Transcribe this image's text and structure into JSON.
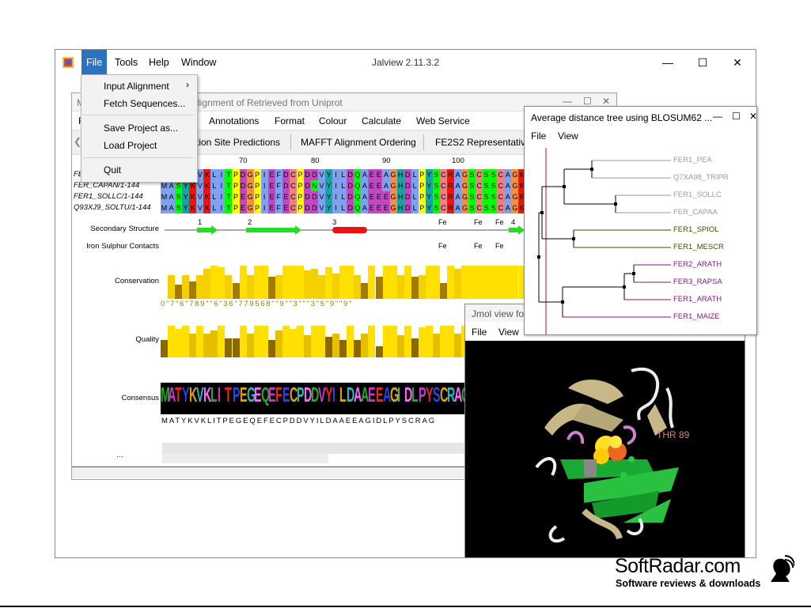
{
  "main_window": {
    "title": "Jalview 2.11.3.2",
    "menu": [
      "File",
      "Tools",
      "Help",
      "Window"
    ]
  },
  "file_menu": {
    "items": [
      "Input Alignment",
      "Fetch Sequences...",
      "Save Project as...",
      "Load Project",
      "Quit"
    ]
  },
  "alignment_frame": {
    "title_partial": "M",
    "title_rest": "lignment of Retrieved from Uniprot",
    "menu_partial": "F",
    "menu": [
      "Annotations",
      "Format",
      "Colour",
      "Calculate",
      "Web Service"
    ],
    "tabs": [
      "tion Site Predictions",
      "MAFFT Alignment Ordering",
      "FE2S2 Representatives"
    ],
    "ruler": [
      "70",
      "80",
      "90",
      "100"
    ],
    "sequences": [
      {
        "name": "FER",
        "seq": "MASYKVKLITPDGPIEFDCPDDVYILDQAEEAGHDLPYSCRAGSCSSCAGK"
      },
      {
        "name": "FER_CAPAN/1-144",
        "seq": "MASYKVKLITPDGPIEFDCPDNVYILDQAEEAGHDLPYSCRAGSCSSCAGK"
      },
      {
        "name": "FER1_SOLLC/1-144",
        "seq": "MASYKVKLITPEGPIEFECPDDVYILDQAEEEGHDLPYSCRAGSCSSCAGK"
      },
      {
        "name": "Q93XJ9_SOLTU/1-144",
        "seq": "MASYKVKLITPEGPIEFECPDDVYILDQAEEEGHDLPYSCRAGSCSSCAGK"
      }
    ],
    "annotations": {
      "secondary_structure": "Secondary Structure",
      "ss_numbers": [
        "1",
        "2",
        "3",
        "4"
      ],
      "iron_sulphur": "Iron Sulphur Contacts",
      "fe": "Fe",
      "conservation": "Conservation",
      "conservation_digits": "0\"7\"6\"789\"\"6\"36\"779568\"\"9\"\"3\"\"\"3\"5\"9\"\"9\"",
      "quality": "Quality",
      "consensus": "Consensus",
      "consensus_seq": "MATYKVKLITPEGEQEFECPDDVYILDAAEEAGIDLPYSCRAG"
    }
  },
  "tree_window": {
    "title": "Average distance tree using BLOSUM62 ...",
    "menu": [
      "File",
      "View"
    ],
    "leaves": [
      {
        "name": "FER1_PEA",
        "color": "#9a9a9a"
      },
      {
        "name": "Q7XA98_TRIPR",
        "color": "#9a9a9a"
      },
      {
        "name": "FER1_SOLLC",
        "color": "#9a9a9a"
      },
      {
        "name": "FER_CAPAA",
        "color": "#9a9a9a"
      },
      {
        "name": "FER1_SPIOL",
        "color": "#4a4a00"
      },
      {
        "name": "FER1_MESCR",
        "color": "#4a4a00"
      },
      {
        "name": "FER2_ARATH",
        "color": "#7a1a7a"
      },
      {
        "name": "FER3_RAPSA",
        "color": "#7a1a7a"
      },
      {
        "name": "FER1_ARATH",
        "color": "#7a1a7a"
      },
      {
        "name": "FER1_MAIZE",
        "color": "#7a1a7a"
      }
    ]
  },
  "jmol_window": {
    "title": "Jmol view fo",
    "menu": [
      "File",
      "View"
    ],
    "label": "THR 89"
  },
  "watermark": {
    "brand": "SoftRadar.com",
    "tagline": "Software reviews & downloads"
  },
  "colors": {
    "accent": "#2a73c0",
    "conservation_bar": "#ffe000",
    "conservation_dark": "#9a7a00"
  }
}
